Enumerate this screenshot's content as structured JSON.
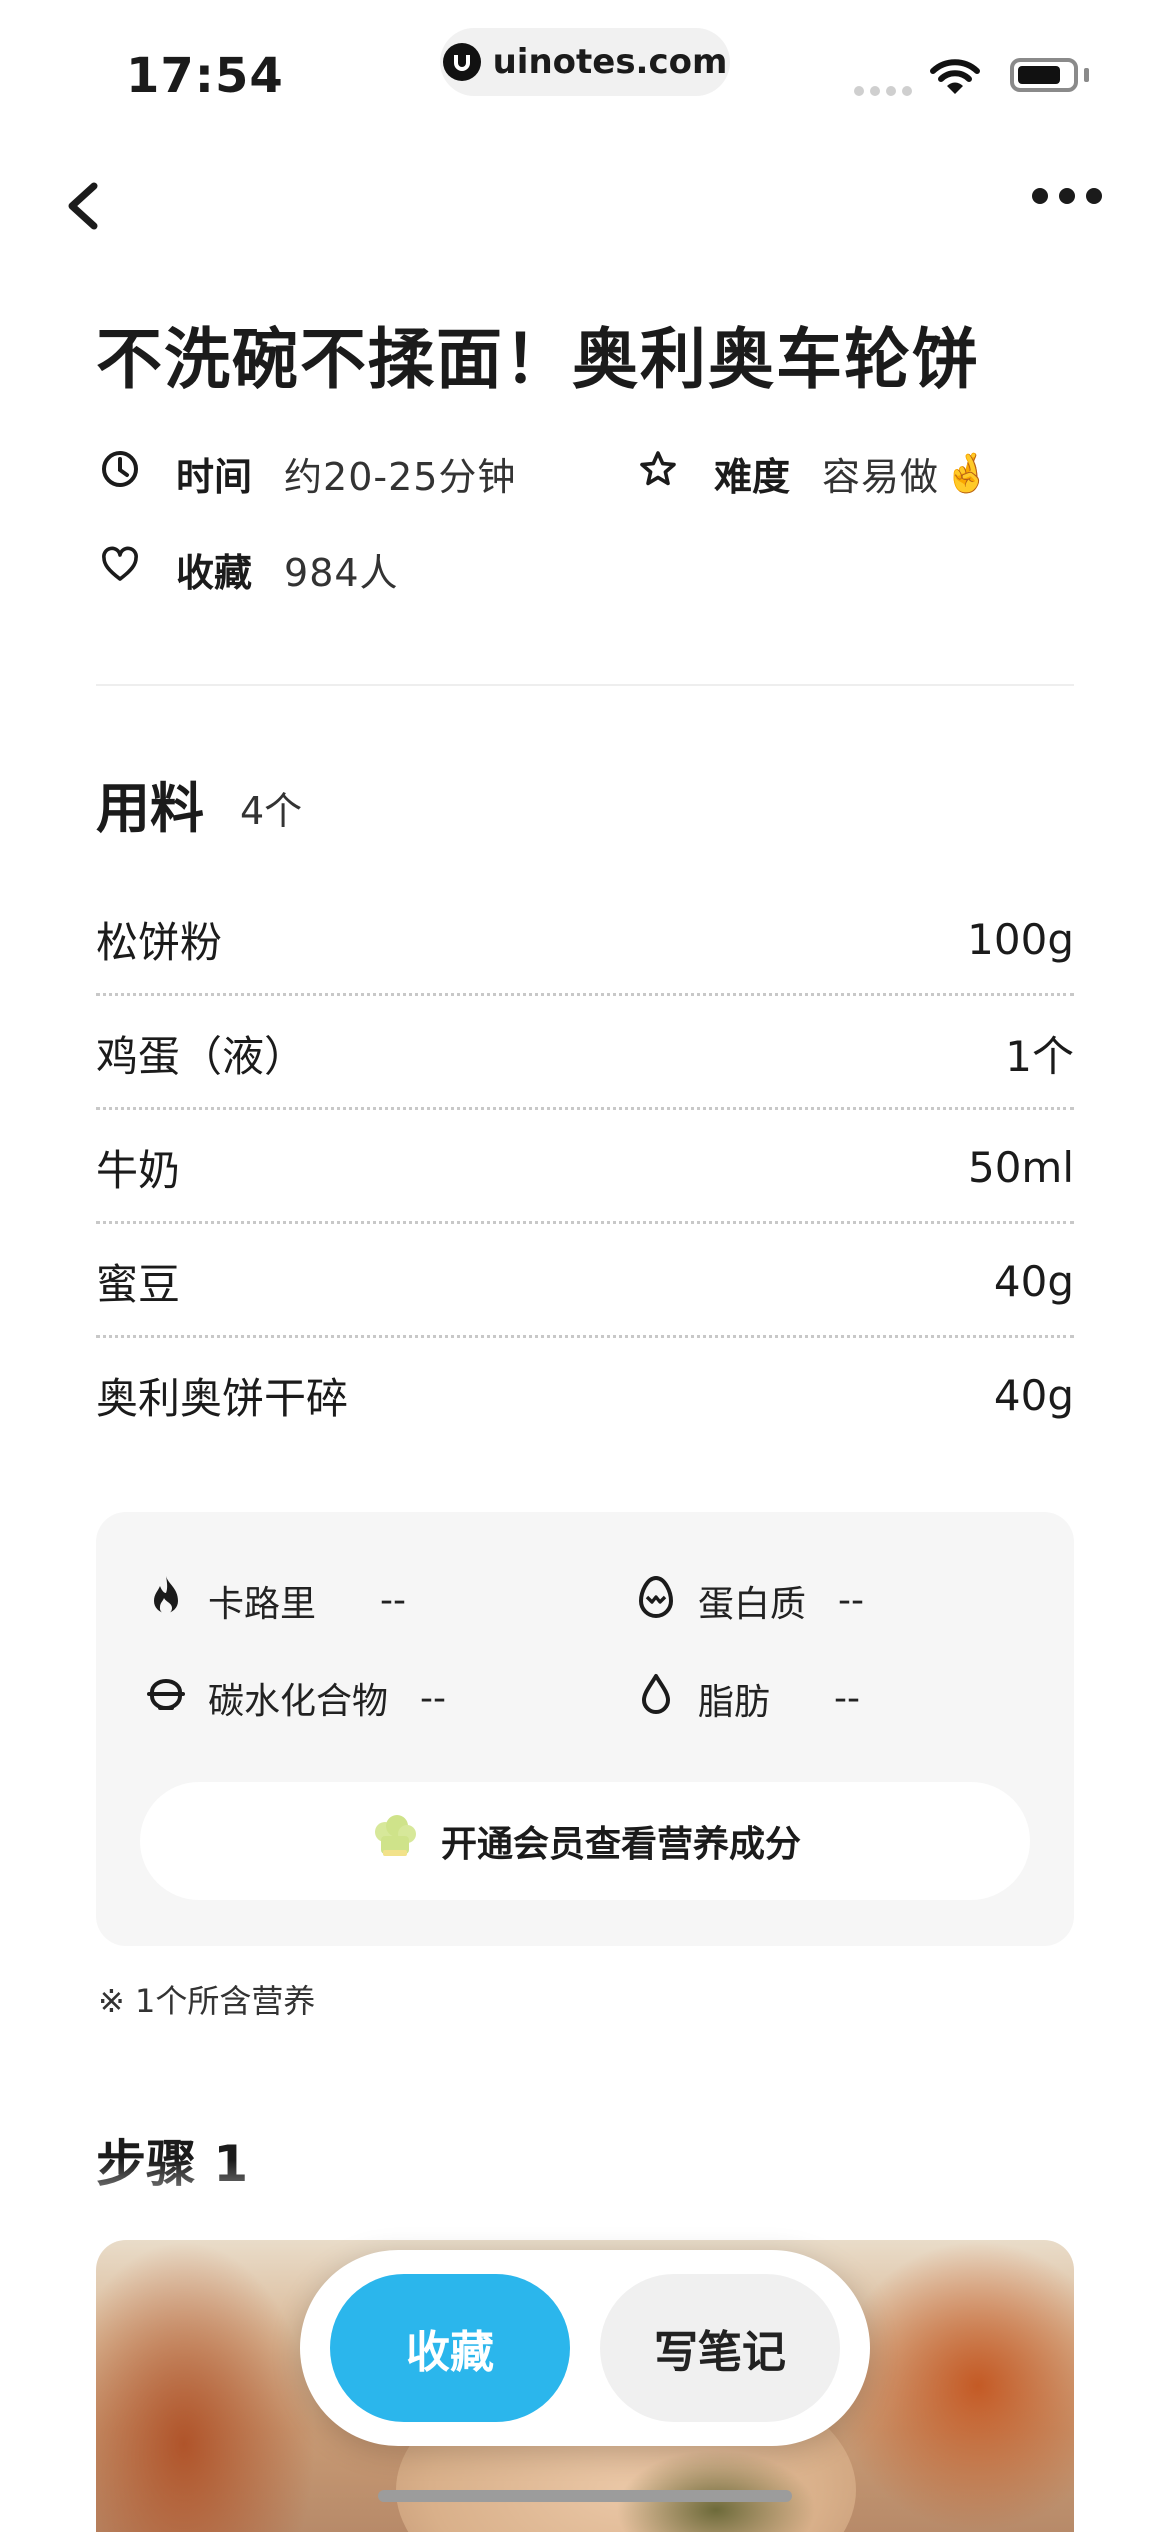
{
  "status_bar": {
    "time": "17:54",
    "url": "uinotes.com"
  },
  "recipe": {
    "title": "不洗碗不揉面！奥利奥车轮饼",
    "time_label": "时间",
    "time_value": "约20-25分钟",
    "difficulty_label": "难度",
    "difficulty_value": "容易做",
    "difficulty_emoji": "🤞",
    "favorites_label": "收藏",
    "favorites_value": "984人"
  },
  "ingredients": {
    "title": "用料",
    "count": "4个",
    "items": [
      {
        "name": "松饼粉",
        "amount": "100g"
      },
      {
        "name": "鸡蛋（液）",
        "amount": "1个"
      },
      {
        "name": "牛奶",
        "amount": "50ml"
      },
      {
        "name": "蜜豆",
        "amount": "40g"
      },
      {
        "name": "奥利奥饼干碎",
        "amount": "40g"
      }
    ]
  },
  "nutrition": {
    "calories_label": "卡路里",
    "calories_value": "--",
    "protein_label": "蛋白质",
    "protein_value": "--",
    "carbs_label": "碳水化合物",
    "carbs_value": "--",
    "fat_label": "脂肪",
    "fat_value": "--",
    "vip_button": "开通会员查看营养成分",
    "footnote": "※ 1个所含营养"
  },
  "steps": {
    "step1_title": "步骤 1"
  },
  "actions": {
    "favorite": "收藏",
    "write_note": "写笔记"
  },
  "colors": {
    "accent": "#2bb6ec",
    "card_bg": "#f6f6f6",
    "text": "#1b1b1b"
  }
}
